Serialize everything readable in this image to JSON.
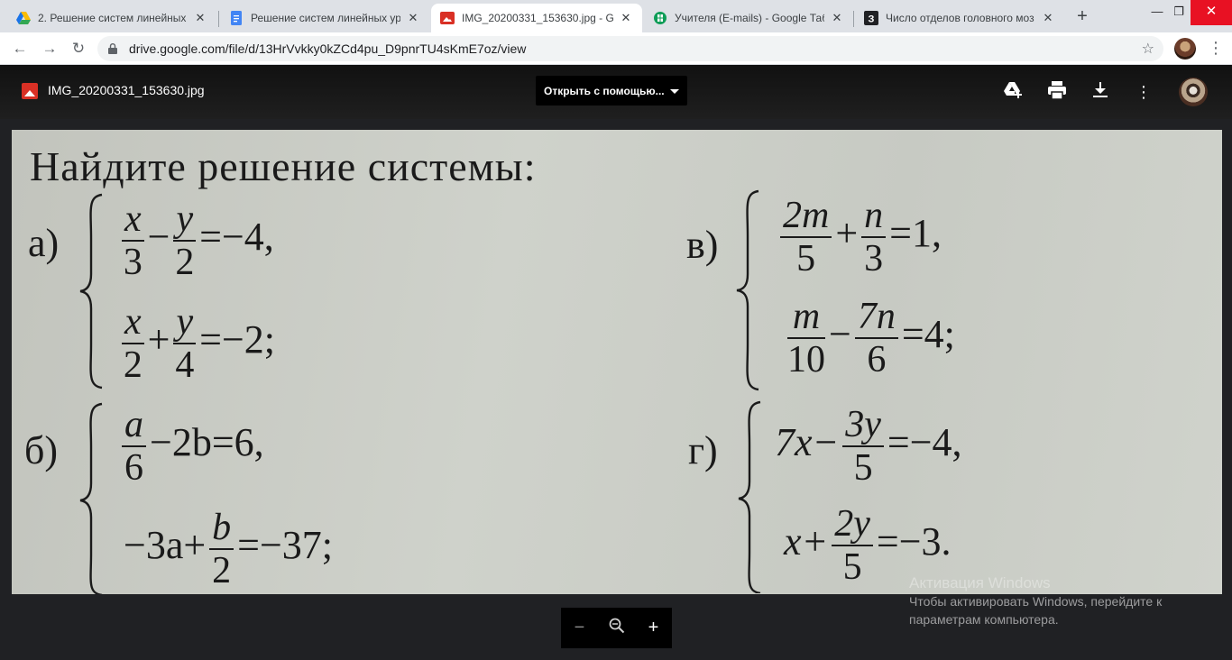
{
  "tabs": [
    {
      "title": "2. Решение систем линейных у",
      "active": false,
      "icon": "google-drive-icon"
    },
    {
      "title": "Решение систем линейных ура",
      "active": false,
      "icon": "google-docs-icon"
    },
    {
      "title": "IMG_20200331_153630.jpg - Go",
      "active": true,
      "icon": "image-file-icon"
    },
    {
      "title": "Учителя (E-mails) - Google Таб",
      "active": false,
      "icon": "google-sheets-icon"
    },
    {
      "title": "Число отделов головного моз",
      "active": false,
      "icon": "z-site-icon"
    }
  ],
  "address_bar": {
    "url": "drive.google.com/file/d/13HrVvkky0kZCd4pu_D9pnrTU4sKmE7oz/view"
  },
  "viewer": {
    "file_name": "IMG_20200331_153630.jpg",
    "open_with_label": "Открыть с помощью...",
    "actions": [
      "add-to-drive-icon",
      "print-icon",
      "download-icon",
      "more-options-icon"
    ]
  },
  "photo_content": {
    "heading": "Найдите решение системы:",
    "labels": {
      "a": "а)",
      "b": "б)",
      "v": "в)",
      "g": "г)"
    },
    "a_eq1": {
      "n1": "x",
      "d1": "3",
      "op": "−",
      "n2": "y",
      "d2": "2",
      "rhs": "=−4,"
    },
    "a_eq2": {
      "n1": "x",
      "d1": "2",
      "op": "+",
      "n2": "y",
      "d2": "4",
      "rhs": "=−2;"
    },
    "b_eq1": {
      "n1": "a",
      "d1": "6",
      "rest": "−2b=6,"
    },
    "b_eq2": {
      "pre": "−3a+",
      "n1": "b",
      "d1": "2",
      "rhs": "=−37;"
    },
    "v_eq1": {
      "n1": "2m",
      "d1": "5",
      "op": "+",
      "n2": "n",
      "d2": "3",
      "rhs": "=1,"
    },
    "v_eq2": {
      "n1": "m",
      "d1": "10",
      "op": "−",
      "n2": "7n",
      "d2": "6",
      "rhs": "=4;"
    },
    "g_eq1": {
      "pre": "7x−",
      "n1": "3y",
      "d1": "5",
      "rhs": "=−4,"
    },
    "g_eq2": {
      "pre": "x+",
      "n1": "2y",
      "d1": "5",
      "rhs": "=−3."
    }
  },
  "zoom_controls": {
    "zoom_out": "−",
    "zoom_in": "+"
  },
  "windows_activation": {
    "line1": "Активация Windows",
    "line2": "Чтобы активировать Windows, перейдите к",
    "line3": "параметрам компьютера."
  }
}
